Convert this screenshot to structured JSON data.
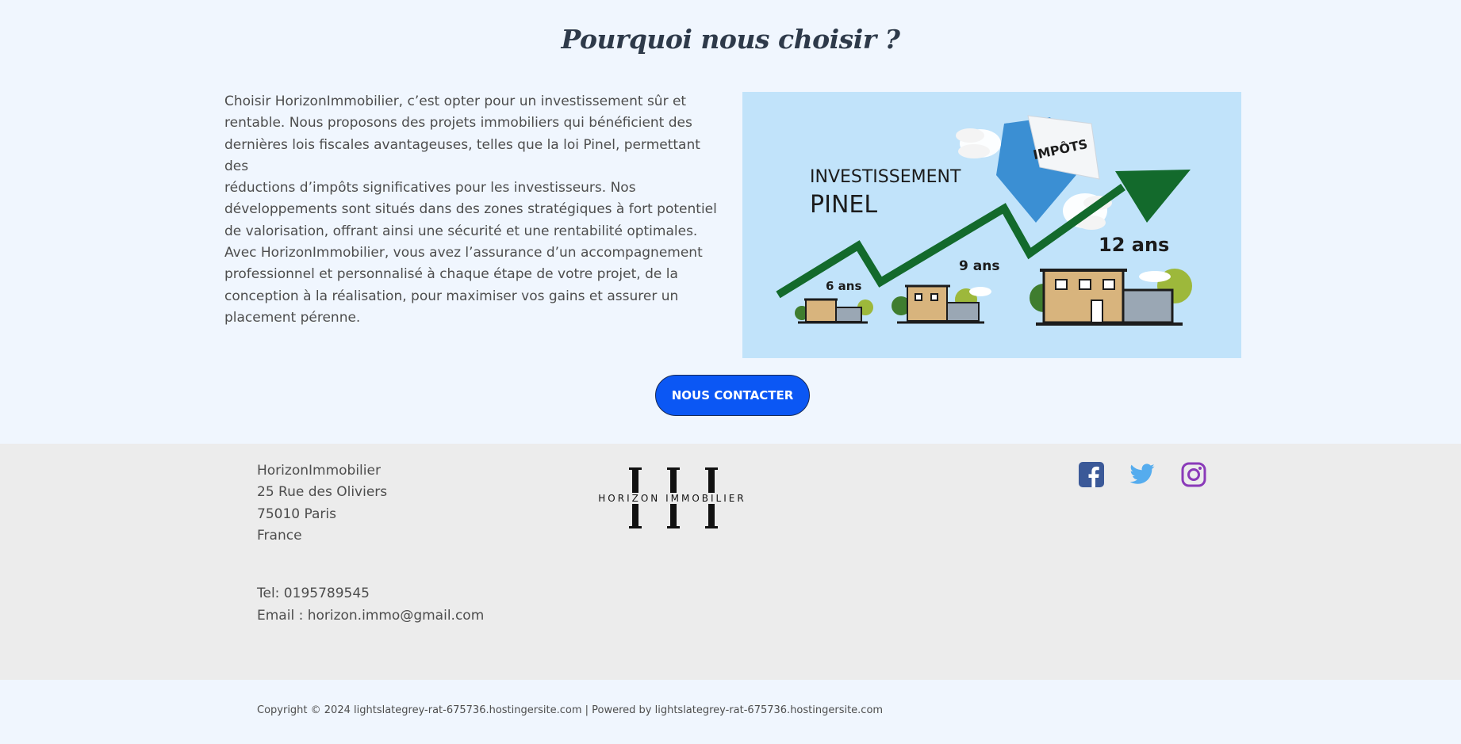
{
  "why": {
    "title": "Pourquoi nous choisir ?",
    "paragraph_lines": [
      "Choisir HorizonImmobilier, c’est opter pour un investissement sûr et",
      "rentable. Nous proposons des projets immobiliers qui bénéficient des",
      "dernières lois fiscales avantageuses, telles que la loi Pinel, permettant des",
      "réductions d’impôts significatives pour les investisseurs. Nos",
      "développements sont situés dans des zones stratégiques à fort potentiel",
      "de valorisation, offrant ainsi une sécurité et une rentabilité optimales.",
      "Avec HorizonImmobilier, vous avez l’assurance d’un accompagnement",
      "professionnel et personnalisé à chaque étape de votre projet, de la",
      "conception à la réalisation, pour maximiser vos gains et assurer un",
      "placement pérenne."
    ],
    "image": {
      "heading_1": "INVESTISSEMENT",
      "heading_2": "PINEL",
      "envelope_label": "IMPÔTS",
      "label_6": "6 ans",
      "label_9": "9 ans",
      "label_12": "12 ans"
    },
    "cta_label": "NOUS CONTACTER"
  },
  "footer": {
    "address": [
      "HorizonImmobilier",
      "25 Rue des Oliviers",
      "75010 Paris",
      "France"
    ],
    "tel": "Tel: 0195789545",
    "email": "Email : horizon.immo@gmail.com",
    "logo_text": "HORIZON IMMOBILIER",
    "social": [
      "facebook-icon",
      "twitter-icon",
      "instagram-icon"
    ],
    "copyright_prefix": "Copyright © 2024 ",
    "copyright_site": "lightslategrey-rat-675736.hostingersite.com",
    "copyright_sep": " | Powered by ",
    "powered_site": "lightslategrey-rat-675736.hostingersite.com"
  },
  "colors": {
    "page_bg": "#f0f6fe",
    "footer_bg": "#ececec",
    "button_bg": "#0b57f4",
    "image_bg": "#c1e3fa",
    "arrow_green": "#136a2c",
    "facebook": "#3b5998",
    "twitter": "#55acee",
    "instagram": "#8a3ab9"
  }
}
